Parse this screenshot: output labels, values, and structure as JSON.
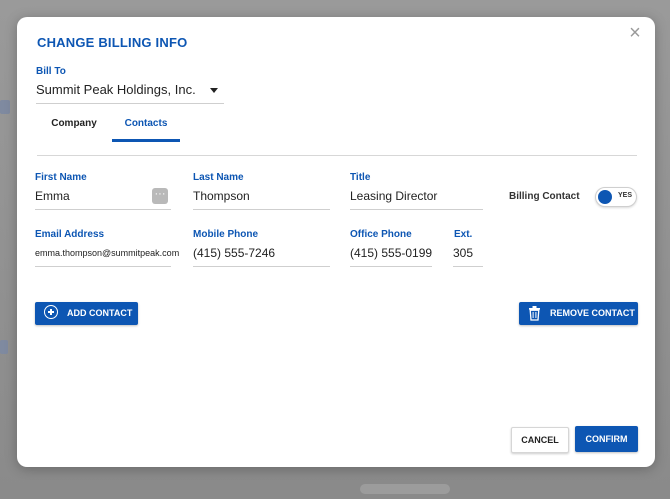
{
  "dialog": {
    "title": "CHANGE BILLING INFO",
    "close_icon": "close-icon"
  },
  "bill_to": {
    "label": "Bill To",
    "value": "Summit Peak Holdings, Inc."
  },
  "tabs": [
    {
      "label": "Company",
      "active": false
    },
    {
      "label": "Contacts",
      "active": true
    }
  ],
  "contact": {
    "first_name_label": "First Name",
    "first_name": "Emma",
    "last_name_label": "Last Name",
    "last_name": "Thompson",
    "title_label": "Title",
    "title": "Leasing Director",
    "billing_contact_label": "Billing Contact",
    "billing_contact_value": "YES",
    "email_label": "Email Address",
    "email": "emma.thompson@summitpeak.com",
    "mobile_label": "Mobile Phone",
    "mobile": "(415) 555-7246",
    "office_label": "Office Phone",
    "office": "(415) 555-0199",
    "ext_label": "Ext.",
    "ext": "305"
  },
  "actions": {
    "add_contact": "ADD CONTACT",
    "remove_contact": "REMOVE CONTACT",
    "cancel": "CANCEL",
    "confirm": "CONFIRM"
  },
  "colors": {
    "accent": "#0d56b3",
    "overlay": "#8e8e8e"
  }
}
